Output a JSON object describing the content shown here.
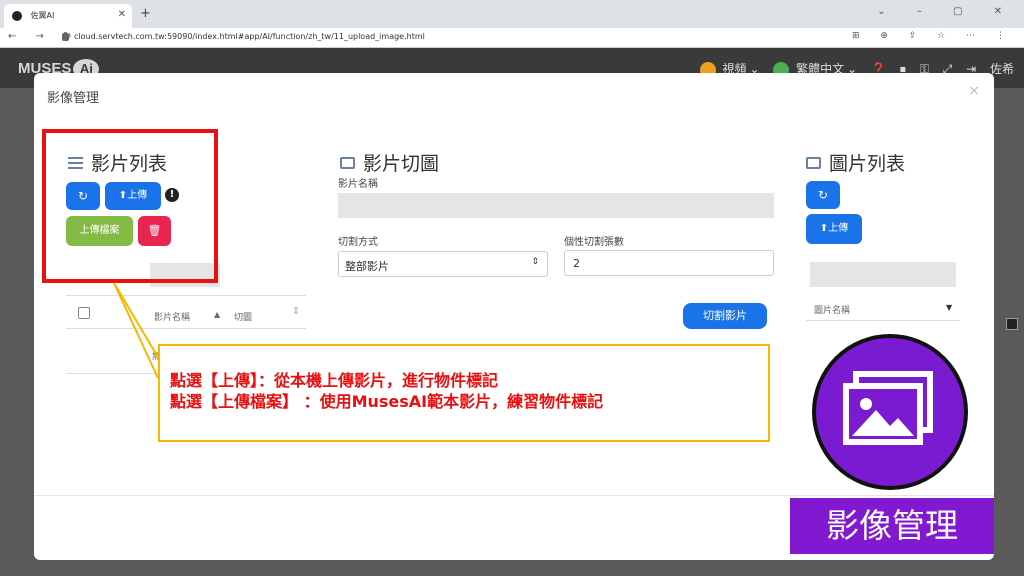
{
  "browser": {
    "tab_title": "佐翼AI",
    "new_tab": "+",
    "window_controls": "⌄ – ▢ ✕",
    "nav": "← → ↻",
    "url": "cloud.servtech.com.tw:59090/index.html#app/AI/function/zh_tw/11_upload_image.html",
    "url_icons": "⊞ ⊕ ⇪ ☆ ⋯ ⋮"
  },
  "app": {
    "logo_text": "MUSES",
    "logo_ai": "Ai",
    "video_menu": "視頻",
    "lang_menu": "繁體中文",
    "user": "佐希"
  },
  "modal": {
    "title": "影像管理",
    "close": "×",
    "left": {
      "title": "影片列表",
      "upload_btn": "上傳",
      "upload_file_btn": "上傳檔案",
      "warn": "!",
      "col_name": "影片名稱",
      "col_cut": "切圖",
      "row_fragment": "無"
    },
    "middle": {
      "title": "影片切圖",
      "name_label": "影片名稱",
      "method_label": "切割方式",
      "method_value": "整部影片",
      "count_label": "個性切割張數",
      "count_value": "2",
      "cut_btn": "切割影片"
    },
    "right": {
      "title": "圖片列表",
      "upload_btn": "上傳",
      "col_name": "圖片名稱"
    }
  },
  "callout": {
    "line1": "點選【上傳】：從本機上傳影片，進行物件標記",
    "line2": "點選【上傳檔案】 ：使用MusesAI範本影片，練習物件標記"
  },
  "badge_label": "影像管理",
  "colors": {
    "primary": "#1a73e8",
    "success": "#84bb46",
    "danger": "#e8244f",
    "highlight_red": "#e81010",
    "callout_border": "#f5b800",
    "badge_purple": "#8019cf"
  }
}
